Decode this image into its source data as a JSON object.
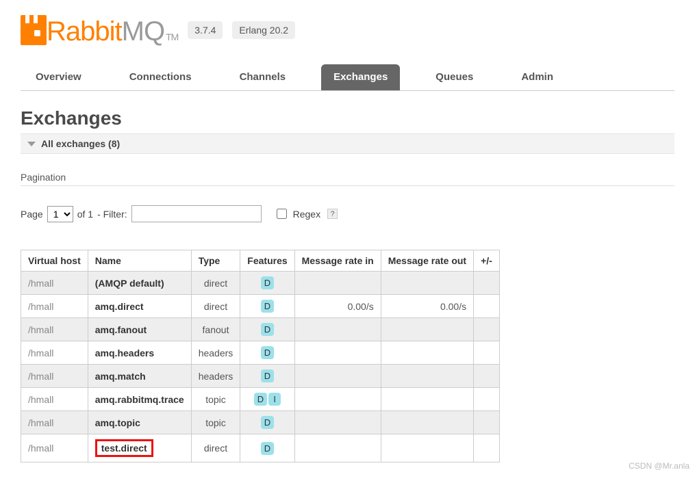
{
  "header": {
    "logo_rabbit": "Rabbit",
    "logo_mq": "MQ",
    "logo_tm": "TM",
    "version": "3.7.4",
    "erlang": "Erlang 20.2"
  },
  "tabs": {
    "t0": "Overview",
    "t1": "Connections",
    "t2": "Channels",
    "t3": "Exchanges",
    "t4": "Queues",
    "t5": "Admin",
    "active": 3
  },
  "title": "Exchanges",
  "section_header": "All exchanges (8)",
  "sub_heading": "Pagination",
  "pager": {
    "page_label": "Page",
    "page_value": "1",
    "of_label": "of 1",
    "filter_label": " - Filter:",
    "filter_value": "",
    "regex_label": "Regex",
    "help": "?"
  },
  "columns": {
    "c0": "Virtual host",
    "c1": "Name",
    "c2": "Type",
    "c3": "Features",
    "c4": "Message rate in",
    "c5": "Message rate out",
    "c6": "+/-"
  },
  "rows": [
    {
      "vhost": "/hmall",
      "name": "(AMQP default)",
      "type": "direct",
      "feat": [
        "D"
      ],
      "in": "",
      "out": "",
      "hl": false
    },
    {
      "vhost": "/hmall",
      "name": "amq.direct",
      "type": "direct",
      "feat": [
        "D"
      ],
      "in": "0.00/s",
      "out": "0.00/s",
      "hl": false
    },
    {
      "vhost": "/hmall",
      "name": "amq.fanout",
      "type": "fanout",
      "feat": [
        "D"
      ],
      "in": "",
      "out": "",
      "hl": false
    },
    {
      "vhost": "/hmall",
      "name": "amq.headers",
      "type": "headers",
      "feat": [
        "D"
      ],
      "in": "",
      "out": "",
      "hl": false
    },
    {
      "vhost": "/hmall",
      "name": "amq.match",
      "type": "headers",
      "feat": [
        "D"
      ],
      "in": "",
      "out": "",
      "hl": false
    },
    {
      "vhost": "/hmall",
      "name": "amq.rabbitmq.trace",
      "type": "topic",
      "feat": [
        "D",
        "I"
      ],
      "in": "",
      "out": "",
      "hl": false
    },
    {
      "vhost": "/hmall",
      "name": "amq.topic",
      "type": "topic",
      "feat": [
        "D"
      ],
      "in": "",
      "out": "",
      "hl": false
    },
    {
      "vhost": "/hmall",
      "name": "test.direct",
      "type": "direct",
      "feat": [
        "D"
      ],
      "in": "",
      "out": "",
      "hl": true
    }
  ],
  "watermark": "CSDN @Mr.anla"
}
